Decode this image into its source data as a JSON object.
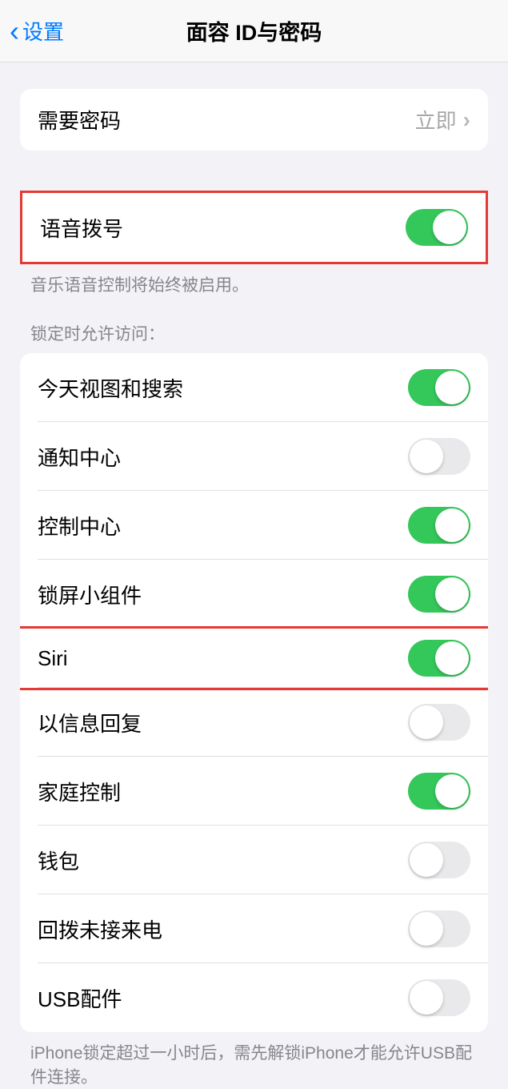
{
  "nav": {
    "back_label": "设置",
    "title": "面容 ID与密码"
  },
  "group1": {
    "require_passcode": {
      "label": "需要密码",
      "value": "立即"
    }
  },
  "group2": {
    "voice_dial": {
      "label": "语音拨号",
      "on": true
    },
    "footer": "音乐语音控制将始终被启用。"
  },
  "group3": {
    "header": "锁定时允许访问：",
    "items": [
      {
        "label": "今天视图和搜索",
        "on": true
      },
      {
        "label": "通知中心",
        "on": false
      },
      {
        "label": "控制中心",
        "on": true
      },
      {
        "label": "锁屏小组件",
        "on": true
      },
      {
        "label": "Siri",
        "on": true
      },
      {
        "label": "以信息回复",
        "on": false
      },
      {
        "label": "家庭控制",
        "on": true
      },
      {
        "label": "钱包",
        "on": false
      },
      {
        "label": "回拨未接来电",
        "on": false
      },
      {
        "label": "USB配件",
        "on": false
      }
    ],
    "footer": "iPhone锁定超过一小时后，需先解锁iPhone才能允许USB配件连接。"
  }
}
